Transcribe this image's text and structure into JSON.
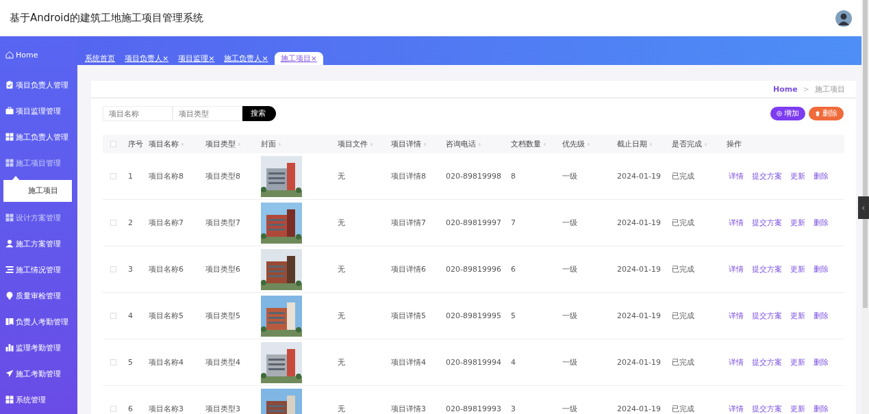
{
  "header": {
    "title": "基于Android的建筑工地施工项目管理系统"
  },
  "sidebar": {
    "items": [
      {
        "label": "Home",
        "highlighted": false
      },
      {
        "label": "项目负责人管理",
        "highlighted": false
      },
      {
        "label": "项目监理管理",
        "highlighted": false
      },
      {
        "label": "施工负责人管理",
        "highlighted": false
      },
      {
        "label": "施工项目管理",
        "highlighted": true,
        "expanded": true,
        "children": [
          {
            "label": "施工项目",
            "selected": true
          }
        ]
      },
      {
        "label": "设计方案管理",
        "highlighted": true
      },
      {
        "label": "施工方案管理",
        "highlighted": false
      },
      {
        "label": "施工情况管理",
        "highlighted": false
      },
      {
        "label": "质量审检管理",
        "highlighted": false
      },
      {
        "label": "负责人考勤管理",
        "highlighted": false
      },
      {
        "label": "监理考勤管理",
        "highlighted": false
      },
      {
        "label": "施工考勤管理",
        "highlighted": false
      },
      {
        "label": "系统管理",
        "highlighted": false
      }
    ]
  },
  "tabs": [
    {
      "label": "系统首页",
      "selected": false
    },
    {
      "label": "项目负责人",
      "close": "×",
      "selected": false
    },
    {
      "label": "项目监理",
      "close": "×",
      "selected": false
    },
    {
      "label": "施工负责人",
      "close": "×",
      "selected": false
    },
    {
      "label": "施工项目",
      "close": "×",
      "selected": true
    }
  ],
  "breadcrumb": [
    {
      "label": "Home",
      "selected": false
    },
    {
      "label": ">",
      "kind": "separator"
    },
    {
      "label": "施工项目",
      "selected": true
    }
  ],
  "search": {
    "fields": [
      {
        "placeholder": "项目名称"
      },
      {
        "placeholder": "项目类型"
      }
    ],
    "button": "搜索"
  },
  "actions": [
    {
      "label": "增加",
      "kind": "add"
    },
    {
      "label": "删除",
      "kind": "delete"
    }
  ],
  "table": {
    "select_all_checked": false,
    "columns": [
      {
        "label": "序号",
        "sortable": false
      },
      {
        "label": "项目名称",
        "sortable": true
      },
      {
        "label": "项目类型",
        "sortable": true
      },
      {
        "label": "封面",
        "sortable": true
      },
      {
        "label": "项目文件",
        "sortable": true
      },
      {
        "label": "项目详情",
        "sortable": true
      },
      {
        "label": "咨询电话",
        "sortable": true
      },
      {
        "label": "文档数量",
        "sortable": true
      },
      {
        "label": "优先级",
        "sortable": true
      },
      {
        "label": "截止日期",
        "sortable": true
      },
      {
        "label": "是否完成",
        "sortable": true
      },
      {
        "label": "操作",
        "sortable": false
      }
    ],
    "rows": [
      {
        "checked": false,
        "cells": [
          "1",
          "项目名称8",
          "项目类型8",
          {
            "kind": "picture"
          },
          "无",
          "项目详情8",
          "020-89819998",
          "8",
          "一级",
          "2024-01-19",
          "已完成"
        ],
        "operations": [
          "详情",
          "提交方案",
          "更新",
          "删除"
        ]
      },
      {
        "checked": false,
        "cells": [
          "2",
          "项目名称7",
          "项目类型7",
          {
            "kind": "picture"
          },
          "无",
          "项目详情7",
          "020-89819997",
          "7",
          "一级",
          "2024-01-19",
          "已完成"
        ],
        "operations": [
          "详情",
          "提交方案",
          "更新",
          "删除"
        ]
      },
      {
        "checked": false,
        "cells": [
          "3",
          "项目名称6",
          "项目类型6",
          {
            "kind": "picture"
          },
          "无",
          "项目详情6",
          "020-89819996",
          "6",
          "一级",
          "2024-01-19",
          "已完成"
        ],
        "operations": [
          "详情",
          "提交方案",
          "更新",
          "删除"
        ]
      },
      {
        "checked": false,
        "cells": [
          "4",
          "项目名称5",
          "项目类型5",
          {
            "kind": "picture"
          },
          "无",
          "项目详情5",
          "020-89819995",
          "5",
          "一级",
          "2024-01-19",
          "已完成"
        ],
        "operations": [
          "详情",
          "提交方案",
          "更新",
          "删除"
        ]
      },
      {
        "checked": false,
        "cells": [
          "5",
          "项目名称4",
          "项目类型4",
          {
            "kind": "picture"
          },
          "无",
          "项目详情4",
          "020-89819994",
          "4",
          "一级",
          "2024-01-19",
          "已完成"
        ],
        "operations": [
          "详情",
          "提交方案",
          "更新",
          "删除"
        ]
      },
      {
        "checked": false,
        "cells": [
          "6",
          "项目名称3",
          "项目类型3",
          {
            "kind": "picture"
          },
          "无",
          "项目详情3",
          "020-89819993",
          "3",
          "一级",
          "2024-01-19",
          "已完成"
        ],
        "operations": [
          "详情",
          "提交方案",
          "更新",
          "删除"
        ]
      }
    ]
  }
}
